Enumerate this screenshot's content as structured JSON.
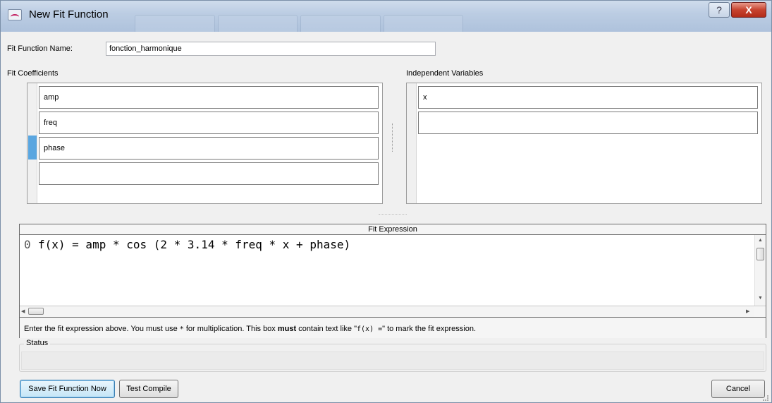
{
  "window": {
    "title": "New Fit Function",
    "help_glyph": "?",
    "close_glyph": "X"
  },
  "fit_function_name": {
    "label": "Fit Function Name:",
    "value": "fonction_harmonique"
  },
  "fit_coefficients": {
    "label": "Fit Coefficients",
    "items": [
      "amp",
      "freq",
      "phase",
      ""
    ],
    "selected_index": 2
  },
  "independent_variables": {
    "label": "Independent Variables",
    "items": [
      "x",
      ""
    ]
  },
  "fit_expression": {
    "header": "Fit Expression",
    "line_number": "0",
    "code": "f(x) = amp * cos (2 * 3.14 * freq * x + phase)",
    "hint_part1": "Enter the fit expression above. You must use ",
    "hint_star": "*",
    "hint_part2": " for multiplication. This box ",
    "hint_must": "must",
    "hint_part3": " contain text like \"",
    "hint_example": "f(x) =",
    "hint_part4": "\" to mark the fit expression."
  },
  "status": {
    "label": "Status",
    "text": ""
  },
  "buttons": {
    "save": "Save Fit Function Now",
    "test": "Test Compile",
    "cancel": "Cancel"
  }
}
